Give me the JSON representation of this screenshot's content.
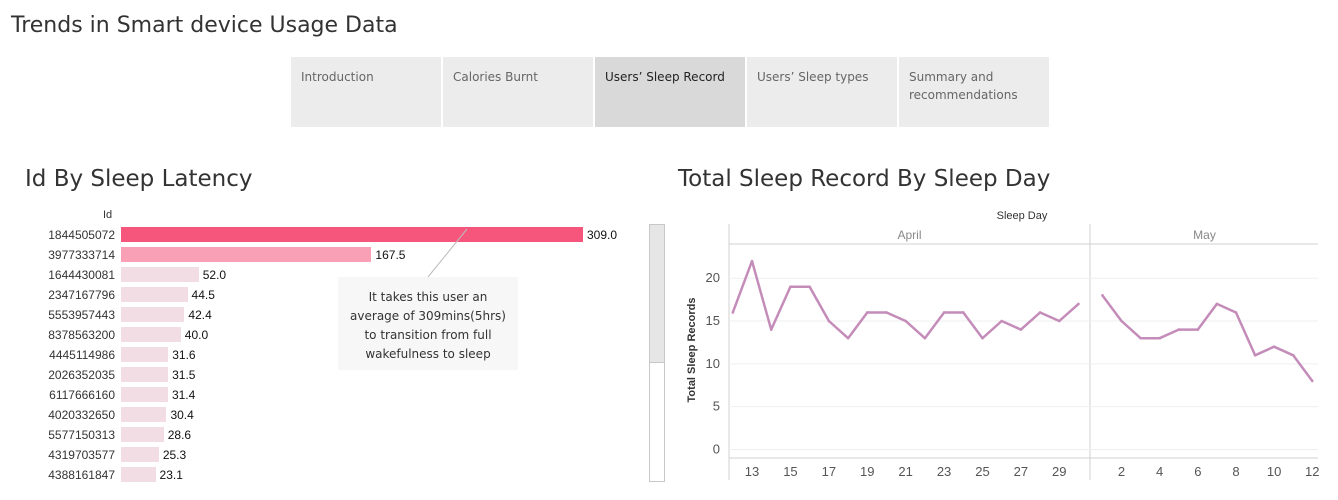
{
  "app_title": "Trends in Smart device Usage Data",
  "tabs": [
    {
      "label": "Introduction",
      "active": false
    },
    {
      "label": "Calories Burnt",
      "active": false
    },
    {
      "label": "Users’ Sleep Record",
      "active": true
    },
    {
      "label": "Users’ Sleep types",
      "active": false
    },
    {
      "label": "Summary and recommendations",
      "active": false
    }
  ],
  "left_title": "Id By Sleep Latency",
  "right_title": "Total Sleep Record By Sleep Day",
  "annotation": "It takes this user an average of  309mins(5hrs) to transition from full wakefulness to sleep",
  "colors": {
    "bar_top": "#f7567c",
    "bar_second": "#f9a0b6",
    "bar_rest": "#f1dde3",
    "line": "#c48cb9"
  },
  "chart_data": [
    {
      "type": "bar",
      "orientation": "horizontal",
      "title": "Id By Sleep Latency",
      "ylabel": "Id",
      "categories": [
        "1844505072",
        "3977333714",
        "1644430081",
        "2347167796",
        "5553957443",
        "8378563200",
        "4445114986",
        "2026352035",
        "6117666160",
        "4020332650",
        "5577150313",
        "4319703577",
        "4388161847"
      ],
      "values": [
        309.0,
        167.5,
        52.0,
        44.5,
        42.4,
        40.0,
        31.6,
        31.5,
        31.4,
        30.4,
        28.6,
        25.3,
        23.1
      ],
      "value_labels": [
        "309.0",
        "167.5",
        "52.0",
        "44.5",
        "42.4",
        "40.0",
        "31.6",
        "31.5",
        "31.4",
        "30.4",
        "28.6",
        "25.3",
        "23.1"
      ]
    },
    {
      "type": "line",
      "title": "Total Sleep Record By Sleep Day",
      "xlabel": "Sleep Day",
      "ylabel": "Total Sleep Records",
      "ylim": [
        -1,
        24
      ],
      "yticks": [
        0,
        5,
        10,
        15,
        20
      ],
      "grid": true,
      "panels": [
        {
          "name": "April",
          "xlim": [
            11.8,
            30.6
          ],
          "xticks": [
            13,
            15,
            17,
            19,
            21,
            23,
            25,
            27,
            29
          ],
          "x": [
            12,
            13,
            14,
            15,
            16,
            17,
            18,
            19,
            20,
            21,
            22,
            23,
            24,
            25,
            26,
            27,
            28,
            29,
            30
          ],
          "y": [
            16,
            22,
            14,
            19,
            19,
            15,
            13,
            16,
            16,
            15,
            13,
            16,
            16,
            13,
            15,
            14,
            16,
            15,
            17
          ]
        },
        {
          "name": "May",
          "xlim": [
            0.4,
            12.3
          ],
          "xticks": [
            2,
            4,
            6,
            8,
            10,
            12
          ],
          "x": [
            1,
            2,
            3,
            4,
            5,
            6,
            7,
            8,
            9,
            10,
            11,
            12
          ],
          "y": [
            18,
            15,
            13,
            13,
            14,
            14,
            17,
            16,
            11,
            12,
            11,
            8
          ]
        }
      ]
    }
  ]
}
